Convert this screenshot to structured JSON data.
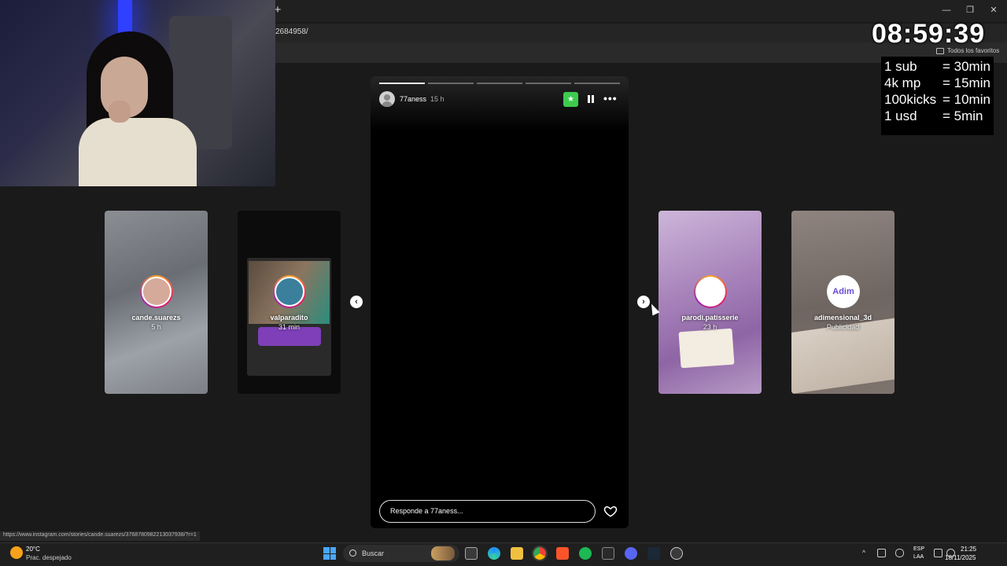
{
  "browser": {
    "new_tab": "+",
    "url_fragment": "2684958/",
    "bookmarks_all": "Todos los favoritos",
    "window_controls": [
      "—",
      "❐",
      "✕"
    ]
  },
  "overlay": {
    "timer": "08:59:39",
    "rules": [
      {
        "k": "1 sub",
        "v": "= 30min"
      },
      {
        "k": "4k mp",
        "v": "= 15min"
      },
      {
        "k": "100kicks",
        "v": "= 10min"
      },
      {
        "k": "1 usd",
        "v": "= 5min"
      }
    ]
  },
  "story": {
    "username": "77aness",
    "time": "15 h",
    "reply_placeholder": "Responde a 77aness...",
    "progress_segments": 5,
    "progress_active": 1
  },
  "cards": [
    {
      "name": "cande.suarezs",
      "time": "5 h"
    },
    {
      "name": "valparadito",
      "time": "31 min"
    },
    {
      "name": "parodi.patisserie",
      "time": "23 h"
    },
    {
      "name": "adimensional_3d",
      "time": "Publicidad",
      "logo": "Adim"
    }
  ],
  "status_link": "https://www.instagram.com/stories/cande.suarezs/3768780982213037938/?r=1",
  "taskbar": {
    "weather_temp": "20°C",
    "weather_desc": "Prac. despejado",
    "search": "Buscar",
    "lang_top": "ESP",
    "lang_bottom": "LAA",
    "time": "21:25",
    "date": "18/11/2025"
  },
  "colors": {
    "star_badge": "#3dcb4e",
    "windows_accent": "#4aa6ff"
  },
  "icons": {
    "nav_prev": "‹",
    "nav_next": "›",
    "star": "★",
    "more": "•••"
  }
}
